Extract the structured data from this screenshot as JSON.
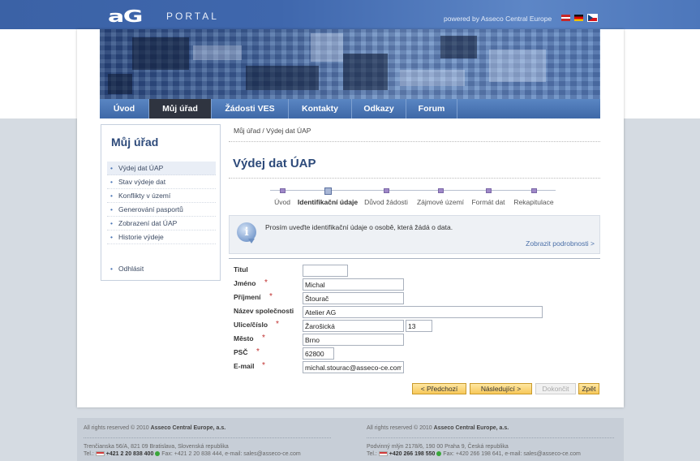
{
  "header": {
    "logo_mark": "aG",
    "logo_text": "PORTAL",
    "powered_by": "powered by Asseco Central Europe",
    "flags": [
      "uk-flag-icon",
      "de-flag-icon",
      "cz-flag-icon"
    ]
  },
  "nav": {
    "items": [
      {
        "label": "Úvod"
      },
      {
        "label": "Můj úřad",
        "active": true
      },
      {
        "label": "Žádosti VES"
      },
      {
        "label": "Kontakty"
      },
      {
        "label": "Odkazy"
      },
      {
        "label": "Forum"
      }
    ]
  },
  "sidebar": {
    "title": "Můj úřad",
    "items": [
      {
        "label": "Výdej dat ÚAP",
        "active": true
      },
      {
        "label": "Stav výdeje dat"
      },
      {
        "label": "Konflikty v území"
      },
      {
        "label": "Generování pasportů"
      },
      {
        "label": "Zobrazení dat ÚAP"
      },
      {
        "label": "Historie výdeje"
      }
    ],
    "logout": "Odhlásit"
  },
  "main": {
    "breadcrumb": "Můj úřad / Výdej dat ÚAP",
    "title": "Výdej dat ÚAP",
    "steps": [
      {
        "label": "Úvod"
      },
      {
        "label": "Identifikační údaje",
        "current": true
      },
      {
        "label": "Důvod žádosti"
      },
      {
        "label": "Zájmové území"
      },
      {
        "label": "Formát dat"
      },
      {
        "label": "Rekapitulace"
      }
    ],
    "info": {
      "text": "Prosím uveďte identifikační údaje o osobě, která žádá o data.",
      "link": "Zobrazit podrobnosti >"
    },
    "form": {
      "titul": {
        "label": "Titul",
        "value": ""
      },
      "jmeno": {
        "label": "Jméno",
        "value": "Michal"
      },
      "prijmeni": {
        "label": "Příjmení",
        "value": "Štourač"
      },
      "spolecnost": {
        "label": "Název společnosti",
        "value": "Atelier AG"
      },
      "ulice": {
        "label": "Ulice/číslo",
        "value": "Žarošická",
        "cislo": "13"
      },
      "mesto": {
        "label": "Město",
        "value": "Brno"
      },
      "psc": {
        "label": "PSČ",
        "value": "62800"
      },
      "email": {
        "label": "E-mail",
        "value": "michal.stourac@asseco-ce.com"
      },
      "required_mark": "*"
    },
    "buttons": {
      "prev": "< Předchozí",
      "next": "Následující >",
      "finish": "Dokončit",
      "back": "Zpět"
    }
  },
  "footer": {
    "left": {
      "copyright_prefix": "All rights reserved © 2010",
      "company": "Asseco Central Europe, a.s.",
      "address": "Trenčianska 56/A, 821 09 Bratislava, Slovenská republika",
      "tel_label": "Tel.:",
      "tel": "+421 2 20 838 400",
      "rest": "Fax: +421 2 20 838 444, e-mail: sales@asseco-ce.com"
    },
    "right": {
      "copyright_prefix": "All rights reserved © 2010",
      "company": "Asseco Central Europe, a.s.",
      "address": "Podvinný mlýn 2178/6, 190 00 Praha 9, Česká republika",
      "tel_label": "Tel.:",
      "tel": "+420 266 198 550",
      "rest": "Fax: +420 266 198 641, e-mail: sales@asseco-ce.com"
    }
  }
}
